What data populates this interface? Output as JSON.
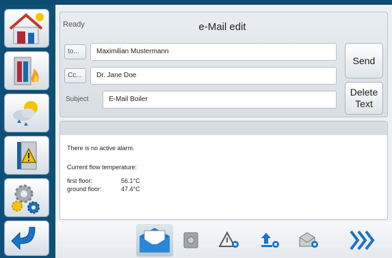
{
  "header": {
    "status": "Ready",
    "title": "e-Mail edit"
  },
  "form": {
    "to_button": "to...",
    "to_value": "Maximilian Mustermann",
    "cc_button": "Cc...",
    "cc_value": "Dr. Jane Doe",
    "subject_label": "Subject",
    "subject_value": "E-Mail Boiler"
  },
  "actions": {
    "send_label": "Send",
    "delete_line1": "Delete",
    "delete_line2": "Text"
  },
  "message": {
    "line1": "There is no active alarm.",
    "line2": "Current flow temperature:",
    "rows": [
      {
        "label": "first floor:",
        "value": "56.1°C"
      },
      {
        "label": "ground floor:",
        "value": "47.4°C"
      }
    ]
  },
  "sidebar": {
    "items": [
      {
        "icon": "house-icon"
      },
      {
        "icon": "boiler-fire-icon"
      },
      {
        "icon": "weather-icon"
      },
      {
        "icon": "alarm-warning-icon"
      },
      {
        "icon": "settings-gears-icon"
      },
      {
        "icon": "back-arrow-icon"
      }
    ]
  },
  "bottom_nav": {
    "items": [
      {
        "icon": "email-icon",
        "active": true
      },
      {
        "icon": "safe-icon"
      },
      {
        "icon": "warning-settings-icon"
      },
      {
        "icon": "upload-settings-icon"
      },
      {
        "icon": "email-settings-icon"
      },
      {
        "icon": "next-chevrons-icon"
      }
    ]
  },
  "colors": {
    "frame_blue": "#0e4f78",
    "accent_blue": "#1a74c6",
    "panel_gray": "#dfe4e9"
  }
}
